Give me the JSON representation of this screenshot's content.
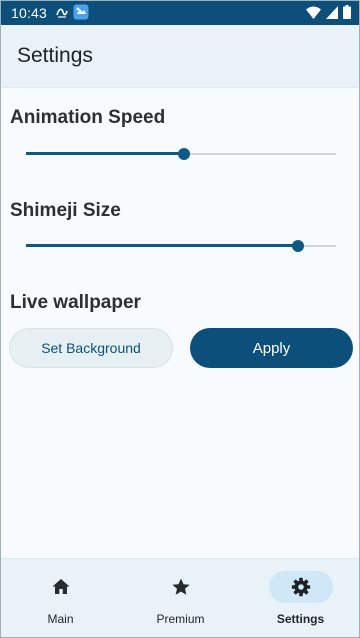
{
  "status_bar": {
    "time": "10:43",
    "icons": [
      "sync-icon",
      "app-notification-icon",
      "wifi-icon",
      "signal-icon",
      "battery-icon"
    ]
  },
  "app_bar": {
    "title": "Settings"
  },
  "animation_speed": {
    "label": "Animation Speed",
    "value_fraction": 0.51
  },
  "shimeji_size": {
    "label": "Shimeji Size",
    "value_fraction": 0.877
  },
  "live_wallpaper": {
    "label": "Live wallpaper",
    "set_background_label": "Set Background",
    "apply_label": "Apply"
  },
  "bottom_nav": {
    "items": [
      {
        "label": "Main",
        "icon": "home-icon",
        "active": false
      },
      {
        "label": "Premium",
        "icon": "star-icon",
        "active": false
      },
      {
        "label": "Settings",
        "icon": "gear-icon",
        "active": true
      }
    ]
  },
  "colors": {
    "primary": "#0b4f7a",
    "background": "#f7fbfd",
    "surface": "#e9f2f6",
    "active_pill": "#cfe7f6"
  }
}
